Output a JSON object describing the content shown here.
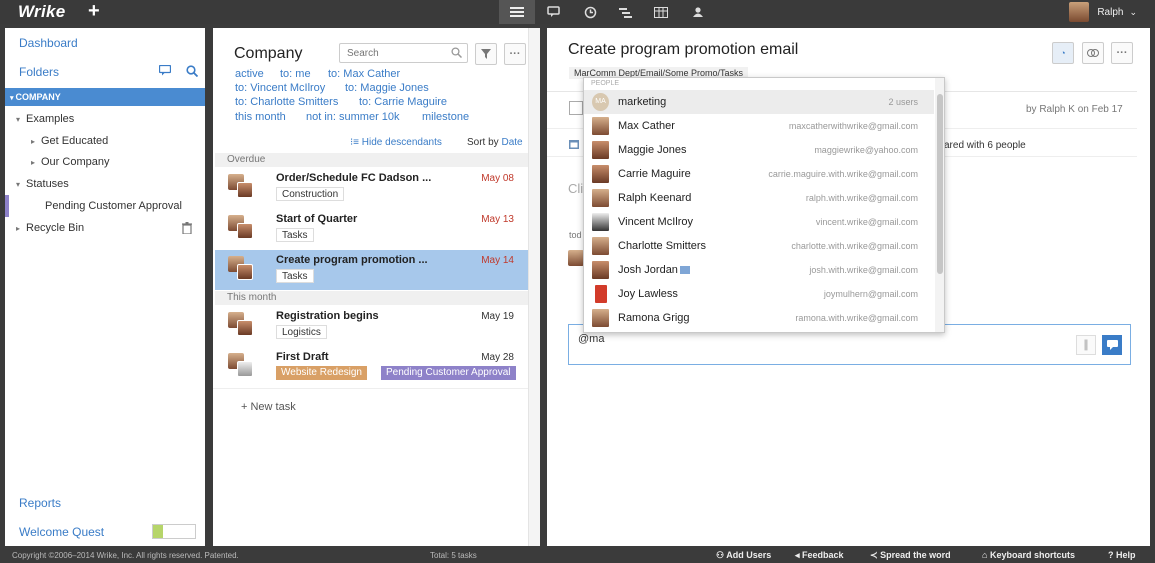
{
  "topbar": {
    "logo": "Wrike",
    "plus": "+",
    "user_name": "Ralph",
    "user_caret": "⌄"
  },
  "sidebar": {
    "dashboard": "Dashboard",
    "folders": "Folders",
    "company": "COMPANY",
    "examples": "Examples",
    "get_educated": "Get Educated",
    "our_company": "Our Company",
    "statuses": "Statuses",
    "pending": "Pending Customer Approval",
    "recycle_bin": "Recycle Bin",
    "reports": "Reports",
    "welcome_quest": "Welcome Quest"
  },
  "list": {
    "title": "Company",
    "search_placeholder": "Search",
    "filters": {
      "f1": "active",
      "f2_label": "to: me",
      "f3_label": "to:",
      "f3_value": "Max Cather",
      "f4_label": "to:",
      "f4_value": "Vincent McIlroy",
      "f5_label": "to:",
      "f5_value": "Maggie Jones",
      "f6_label": "to:",
      "f6_value": "Charlotte Smitters",
      "f7_label": "to:",
      "f7_value": "Carrie Maguire",
      "f8": "this month",
      "f9": "not in: summer 10k",
      "f10": "milestone"
    },
    "hide_descendants": "Hide descendants",
    "sort_label": "Sort by",
    "sort_value": "Date",
    "overdue": "Overdue",
    "this_month": "This month",
    "tasks": [
      {
        "name": "Order/Schedule FC Dadson ...",
        "date": "May 08",
        "tag": "Construction"
      },
      {
        "name": "Start of Quarter",
        "date": "May 13",
        "tag": "Tasks"
      },
      {
        "name": "Create program promotion ...",
        "date": "May 14",
        "tag": "Tasks"
      },
      {
        "name": "Registration begins",
        "date": "May 19",
        "tag": "Logistics"
      },
      {
        "name": "First Draft",
        "date": "May 28",
        "tag": "Website Redesign",
        "tag2": "Pending Customer Approval"
      }
    ],
    "new_task": "+ New task"
  },
  "detail": {
    "title": "Create program promotion email",
    "path": "MarComm Dept/Email/Some Promo/Tasks",
    "by": "by Ralph K on Feb 17",
    "shared": "ared with 6 people",
    "cli": "Cli",
    "tod": "tod",
    "comment_value": "@ma"
  },
  "dropdown": {
    "header": "PEOPLE",
    "items": [
      {
        "name": "marketing",
        "email": "2 users"
      },
      {
        "name": "Max Cather",
        "email": "maxcatherwithwrike@gmail.com"
      },
      {
        "name": "Maggie Jones",
        "email": "maggiewrike@yahoo.com"
      },
      {
        "name": "Carrie Maguire",
        "email": "carrie.maguire.with.wrike@gmail.com"
      },
      {
        "name": "Ralph Keenard",
        "email": "ralph.with.wrike@gmail.com"
      },
      {
        "name": "Vincent McIlroy",
        "email": "vincent.wrike@gmail.com"
      },
      {
        "name": "Charlotte Smitters",
        "email": "charlotte.with.wrike@gmail.com"
      },
      {
        "name": "Josh Jordan",
        "email": "josh.with.wrike@gmail.com"
      },
      {
        "name": "Joy Lawless",
        "email": "joymulhern@gmail.com"
      },
      {
        "name": "Ramona Grigg",
        "email": "ramona.with.wrike@gmail.com"
      }
    ],
    "marketing_initials": "MA"
  },
  "footer": {
    "copyright": "Copyright ©2006–2014 Wrike, Inc. All rights reserved. Patented.",
    "total": "Total: 5 tasks",
    "add_users": "Add Users",
    "feedback": "Feedback",
    "spread": "Spread the word",
    "shortcuts": "Keyboard shortcuts",
    "help": "? Help"
  },
  "colors": {
    "accent": "#3a7cc7",
    "selected_row": "#a7c8eb",
    "company_bar": "#4a8bd1",
    "tag_orange": "#d9a066",
    "tag_purple": "#8e82c9",
    "overdue_red": "#c0392b"
  }
}
